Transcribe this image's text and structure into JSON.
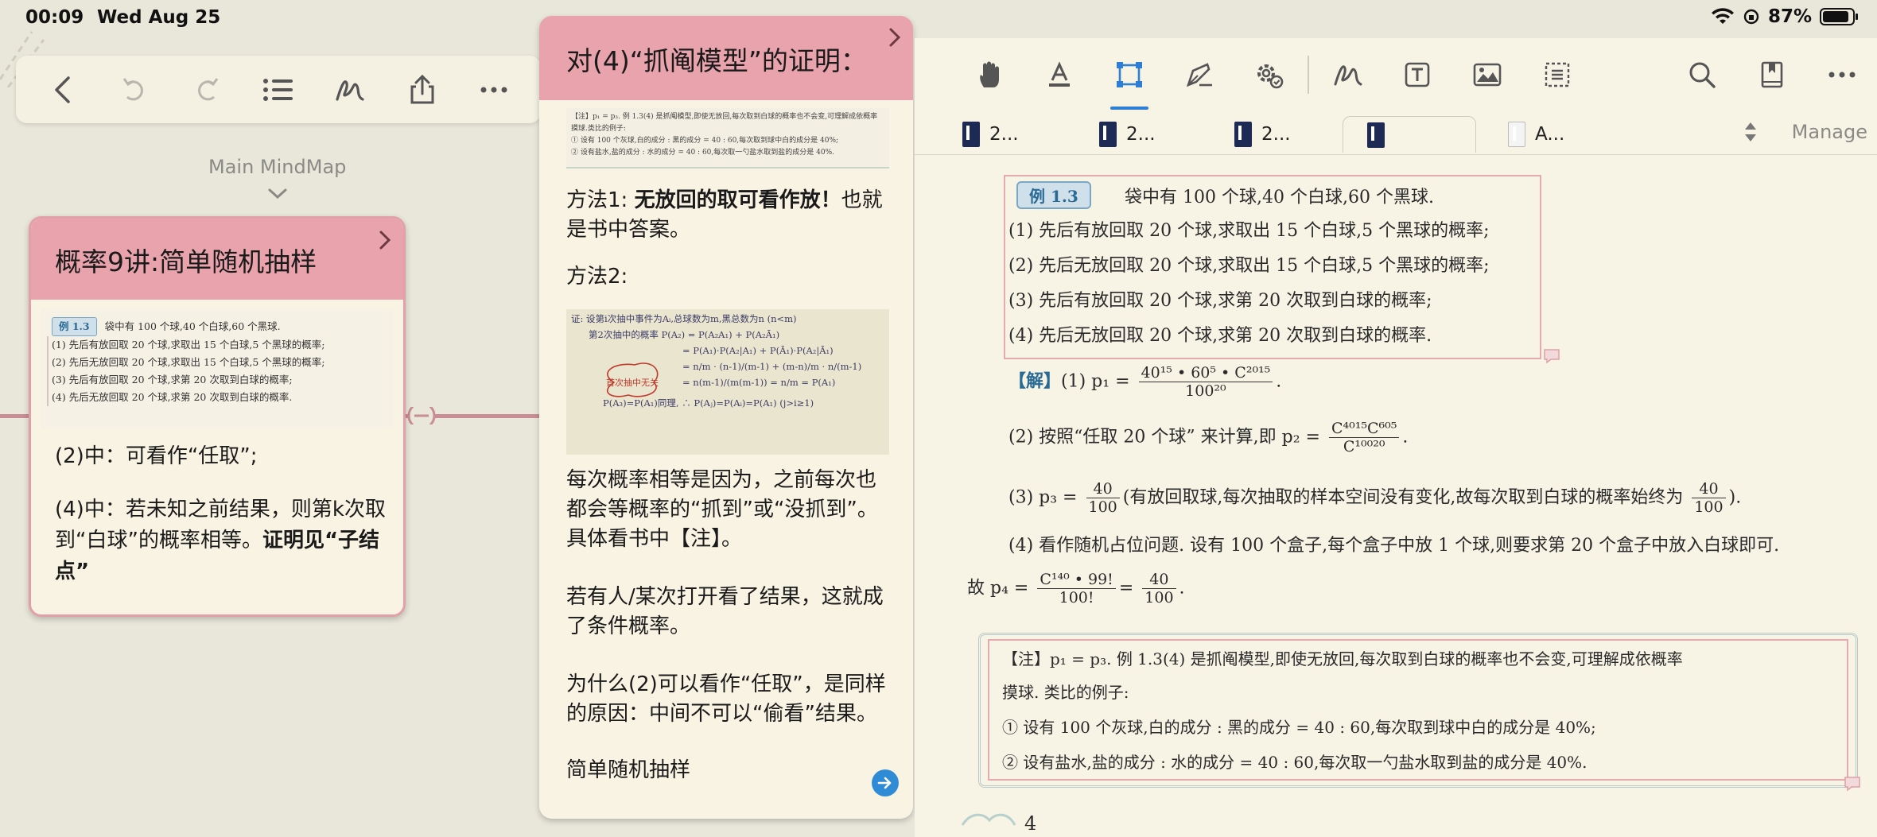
{
  "status": {
    "time": "00:09",
    "date": "Wed Aug 25",
    "battery": "87%"
  },
  "mindmap": {
    "breadcrumb": "Main MindMap",
    "node": {
      "title": "概率9讲:简单随机抽样",
      "thumb": {
        "badge": "例 1.3",
        "stem": "袋中有 100 个球,40 个白球,60 个黑球.",
        "q1": "(1) 先后有放回取 20 个球,求取出 15 个白球,5 个黑球的概率;",
        "q2": "(2) 先后无放回取 20 个球,求取出 15 个白球,5 个黑球的概率;",
        "q3": "(3) 先后有放回取 20 个球,求第 20 次取到白球的概率;",
        "q4": "(4) 先后无放回取 20 个球,求第 20 次取到白球的概率."
      },
      "body1": "(2)中：可看作“任取”;",
      "body2a": "(4)中：若未知之前结果，则第k次取到“白球”的概率相等。",
      "body2b": "证明见“子结点”"
    }
  },
  "note": {
    "title": "对(4)“抓阄模型”的证明：",
    "thumb_lines": [
      "【注】p₁ = p₃. 例 1.3(4) 是抓阄模型,即使无放回,每次取到白球的概率也不会变,可理解成依概率",
      "摸球.类比的例子:",
      "① 设有 100 个灰球,白的成分 : 黑的成分 = 40 : 60,每次取到球中白的成分是 40%;",
      "② 设有盐水,盐的成分 : 水的成分 = 40 : 60,每次取一勺盐水取到盐的成分是 40%."
    ],
    "method1_prefix": "方法1: ",
    "method1_bold": "无放回的取可看作放！",
    "method1_suffix": "也就是书中答案。",
    "method2": "方法2:",
    "hand_lines": [
      "证: 设第i次抽中事件为Aᵢ,总球数为m,黑总数为n (n<m)",
      "第2次抽中的概率 P(A₂) = P(A₂A₁) + P(A₂Ā₁)",
      "= P(A₁)·P(A₂|A₁) + P(Ā₁)·P(A₂|Ā₁)",
      "= n/m · (n-1)/(m-1) + (m-n)/m · n/(m-1)",
      "= n(m-1)/(m(m-1)) = n/m = P(A₁)",
      "P(A₃)=P(A₁)同理, ∴ P(Aⱼ)=P(Aᵢ)=P(A₁)  (j>i≥1)",
      "首次抽中无关"
    ],
    "p1": "每次概率相等是因为，之前每次也都会等概率的“抓到”或“没抓到”。具体看书中【注】。",
    "p2": "若有人/某次打开看了结果，这就成了条件概率。",
    "p3": "为什么(2)可以看作“任取”，是同样的原因：中间不可以“偷看”结果。",
    "link_label": "简单随机抽样"
  },
  "pdf": {
    "tabs": [
      {
        "label": "2..."
      },
      {
        "label": "2..."
      },
      {
        "label": "2..."
      },
      {
        "label": ""
      },
      {
        "label": "A..."
      }
    ],
    "manage": "Manage",
    "example": {
      "badge": "例 1.3",
      "stem": "袋中有 100 个球,40 个白球,60 个黑球.",
      "q1": "(1) 先后有放回取 20 个球,求取出 15 个白球,5 个黑球的概率;",
      "q2": "(2) 先后无放回取 20 个球,求取出 15 个白球,5 个黑球的概率;",
      "q3": "(3) 先后有放回取 20 个球,求第 20 次取到白球的概率;",
      "q4": "(4) 先后无放回取 20 个球,求第 20 次取到白球的概率."
    },
    "sol": {
      "tag": "【解】",
      "s1_lead": "(1) p₁ =",
      "s1_num": "40¹⁵ • 60⁵ • C²⁰¹⁵",
      "s1_den": "100²⁰",
      "s2_lead": "(2) 按照“任取 20 个球” 来计算,即 p₂ =",
      "s2_num": "C⁴⁰¹⁵C⁶⁰⁵",
      "s2_den": "C¹⁰⁰²⁰",
      "s3_lead": "(3) p₃ =",
      "s3_num": "40",
      "s3_den": "100",
      "s3_mid": "(有放回取球,每次抽取的样本空间没有变化,故每次取到白球的概率始终为",
      "s3_tail": ").",
      "s4": "(4) 看作随机占位问题. 设有 100 个盒子,每个盒子中放 1 个球,则要求第 20 个盒子中放入白球即可.",
      "s4b_lead": "故 p₄ =",
      "s4b_num": "C¹⁴⁰ • 99!",
      "s4b_den": "100!",
      "s4b_eq": "=",
      "s4b_num2": "40",
      "s4b_den2": "100"
    },
    "note_lines": [
      "【注】p₁ = p₃. 例 1.3(4) 是抓阄模型,即使无放回,每次取到白球的概率也不会变,可理解成依概率",
      "摸球. 类比的例子:",
      "① 设有 100 个灰球,白的成分 : 黑的成分 = 40 : 60,每次取到球中白的成分是 40%;",
      "② 设有盐水,盐的成分 : 水的成分 = 40 : 60,每次取一勺盐水取到盐的成分是 40%."
    ],
    "page": "4"
  }
}
